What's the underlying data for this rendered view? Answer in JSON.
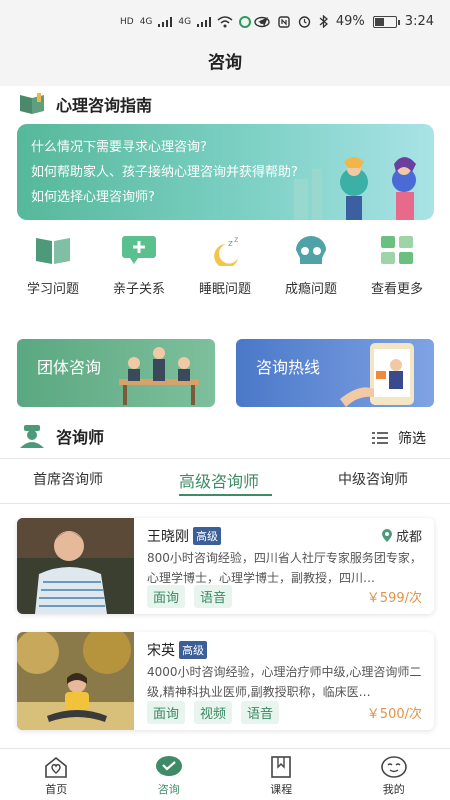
{
  "status_bar": {
    "left_labels": [
      "HD",
      "4G",
      "4G"
    ],
    "battery": "49%",
    "battery_level": 0.49,
    "time": "3:24"
  },
  "header": {
    "title": "咨询"
  },
  "guide": {
    "title": "心理咨询指南",
    "banner_lines": [
      "什么情况下需要寻求心理咨询?",
      "如何帮助家人、孩子接纳心理咨询并获得帮助?",
      "如何选择心理咨询师?"
    ]
  },
  "categories": [
    {
      "label": "学习问题",
      "icon": "book-icon"
    },
    {
      "label": "亲子关系",
      "icon": "message-plus-icon"
    },
    {
      "label": "睡眠问题",
      "icon": "moon-zzz-icon"
    },
    {
      "label": "成瘾问题",
      "icon": "skull-icon"
    },
    {
      "label": "查看更多",
      "icon": "grid-icon"
    }
  ],
  "services": {
    "group": "团体咨询",
    "hotline": "咨询热线"
  },
  "counselors": {
    "title": "咨询师",
    "filter_label": "筛选",
    "tabs": [
      "首席咨询师",
      "高级咨询师",
      "中级咨询师"
    ],
    "active_tab": 1,
    "items": [
      {
        "name": "王晓刚",
        "level": "高级",
        "location": "成都",
        "desc": "800小时咨询经验，四川省人社厅专家服务团专家，心理学博士，心理学博士，副教授，四川…",
        "services": [
          "面询",
          "语音"
        ],
        "price": "￥599/次"
      },
      {
        "name": "宋英",
        "level": "高级",
        "location": "",
        "desc": "4000小时咨询经验，心理治疗师中级,心理咨询师二级,精神科执业医师,副教授职称，临床医…",
        "services": [
          "面询",
          "视频",
          "语音"
        ],
        "price": "￥500/次"
      }
    ]
  },
  "bottom_nav": [
    {
      "label": "首页",
      "icon": "home-heart-icon"
    },
    {
      "label": "咨询",
      "icon": "chat-icon"
    },
    {
      "label": "课程",
      "icon": "bookmark-book-icon"
    },
    {
      "label": "我的",
      "icon": "smile-face-icon"
    }
  ],
  "colors": {
    "accent": "#3f8a67",
    "price": "#e1934a",
    "badge": "#3d5f98"
  }
}
